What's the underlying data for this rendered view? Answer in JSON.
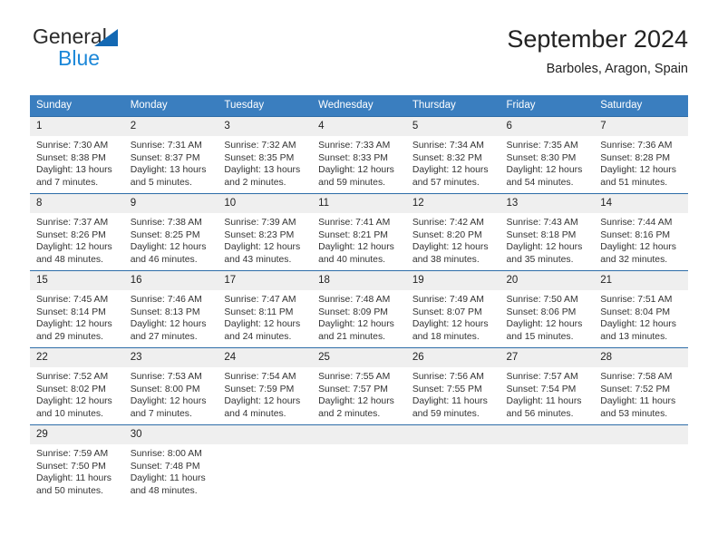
{
  "brand": {
    "name_part1": "General",
    "name_part2": "Blue",
    "triangle_color": "#1368b3",
    "blue_text_color": "#1b87d8"
  },
  "header": {
    "title": "September 2024",
    "subtitle": "Barboles, Aragon, Spain"
  },
  "theme": {
    "header_row_bg": "#3a7ebf",
    "row_divider": "#2e6da8",
    "daynum_bg": "#efefef"
  },
  "weekday_headers": [
    "Sunday",
    "Monday",
    "Tuesday",
    "Wednesday",
    "Thursday",
    "Friday",
    "Saturday"
  ],
  "weeks": [
    [
      {
        "day": "1",
        "sunrise": "Sunrise: 7:30 AM",
        "sunset": "Sunset: 8:38 PM",
        "daylight1": "Daylight: 13 hours",
        "daylight2": "and 7 minutes."
      },
      {
        "day": "2",
        "sunrise": "Sunrise: 7:31 AM",
        "sunset": "Sunset: 8:37 PM",
        "daylight1": "Daylight: 13 hours",
        "daylight2": "and 5 minutes."
      },
      {
        "day": "3",
        "sunrise": "Sunrise: 7:32 AM",
        "sunset": "Sunset: 8:35 PM",
        "daylight1": "Daylight: 13 hours",
        "daylight2": "and 2 minutes."
      },
      {
        "day": "4",
        "sunrise": "Sunrise: 7:33 AM",
        "sunset": "Sunset: 8:33 PM",
        "daylight1": "Daylight: 12 hours",
        "daylight2": "and 59 minutes."
      },
      {
        "day": "5",
        "sunrise": "Sunrise: 7:34 AM",
        "sunset": "Sunset: 8:32 PM",
        "daylight1": "Daylight: 12 hours",
        "daylight2": "and 57 minutes."
      },
      {
        "day": "6",
        "sunrise": "Sunrise: 7:35 AM",
        "sunset": "Sunset: 8:30 PM",
        "daylight1": "Daylight: 12 hours",
        "daylight2": "and 54 minutes."
      },
      {
        "day": "7",
        "sunrise": "Sunrise: 7:36 AM",
        "sunset": "Sunset: 8:28 PM",
        "daylight1": "Daylight: 12 hours",
        "daylight2": "and 51 minutes."
      }
    ],
    [
      {
        "day": "8",
        "sunrise": "Sunrise: 7:37 AM",
        "sunset": "Sunset: 8:26 PM",
        "daylight1": "Daylight: 12 hours",
        "daylight2": "and 48 minutes."
      },
      {
        "day": "9",
        "sunrise": "Sunrise: 7:38 AM",
        "sunset": "Sunset: 8:25 PM",
        "daylight1": "Daylight: 12 hours",
        "daylight2": "and 46 minutes."
      },
      {
        "day": "10",
        "sunrise": "Sunrise: 7:39 AM",
        "sunset": "Sunset: 8:23 PM",
        "daylight1": "Daylight: 12 hours",
        "daylight2": "and 43 minutes."
      },
      {
        "day": "11",
        "sunrise": "Sunrise: 7:41 AM",
        "sunset": "Sunset: 8:21 PM",
        "daylight1": "Daylight: 12 hours",
        "daylight2": "and 40 minutes."
      },
      {
        "day": "12",
        "sunrise": "Sunrise: 7:42 AM",
        "sunset": "Sunset: 8:20 PM",
        "daylight1": "Daylight: 12 hours",
        "daylight2": "and 38 minutes."
      },
      {
        "day": "13",
        "sunrise": "Sunrise: 7:43 AM",
        "sunset": "Sunset: 8:18 PM",
        "daylight1": "Daylight: 12 hours",
        "daylight2": "and 35 minutes."
      },
      {
        "day": "14",
        "sunrise": "Sunrise: 7:44 AM",
        "sunset": "Sunset: 8:16 PM",
        "daylight1": "Daylight: 12 hours",
        "daylight2": "and 32 minutes."
      }
    ],
    [
      {
        "day": "15",
        "sunrise": "Sunrise: 7:45 AM",
        "sunset": "Sunset: 8:14 PM",
        "daylight1": "Daylight: 12 hours",
        "daylight2": "and 29 minutes."
      },
      {
        "day": "16",
        "sunrise": "Sunrise: 7:46 AM",
        "sunset": "Sunset: 8:13 PM",
        "daylight1": "Daylight: 12 hours",
        "daylight2": "and 27 minutes."
      },
      {
        "day": "17",
        "sunrise": "Sunrise: 7:47 AM",
        "sunset": "Sunset: 8:11 PM",
        "daylight1": "Daylight: 12 hours",
        "daylight2": "and 24 minutes."
      },
      {
        "day": "18",
        "sunrise": "Sunrise: 7:48 AM",
        "sunset": "Sunset: 8:09 PM",
        "daylight1": "Daylight: 12 hours",
        "daylight2": "and 21 minutes."
      },
      {
        "day": "19",
        "sunrise": "Sunrise: 7:49 AM",
        "sunset": "Sunset: 8:07 PM",
        "daylight1": "Daylight: 12 hours",
        "daylight2": "and 18 minutes."
      },
      {
        "day": "20",
        "sunrise": "Sunrise: 7:50 AM",
        "sunset": "Sunset: 8:06 PM",
        "daylight1": "Daylight: 12 hours",
        "daylight2": "and 15 minutes."
      },
      {
        "day": "21",
        "sunrise": "Sunrise: 7:51 AM",
        "sunset": "Sunset: 8:04 PM",
        "daylight1": "Daylight: 12 hours",
        "daylight2": "and 13 minutes."
      }
    ],
    [
      {
        "day": "22",
        "sunrise": "Sunrise: 7:52 AM",
        "sunset": "Sunset: 8:02 PM",
        "daylight1": "Daylight: 12 hours",
        "daylight2": "and 10 minutes."
      },
      {
        "day": "23",
        "sunrise": "Sunrise: 7:53 AM",
        "sunset": "Sunset: 8:00 PM",
        "daylight1": "Daylight: 12 hours",
        "daylight2": "and 7 minutes."
      },
      {
        "day": "24",
        "sunrise": "Sunrise: 7:54 AM",
        "sunset": "Sunset: 7:59 PM",
        "daylight1": "Daylight: 12 hours",
        "daylight2": "and 4 minutes."
      },
      {
        "day": "25",
        "sunrise": "Sunrise: 7:55 AM",
        "sunset": "Sunset: 7:57 PM",
        "daylight1": "Daylight: 12 hours",
        "daylight2": "and 2 minutes."
      },
      {
        "day": "26",
        "sunrise": "Sunrise: 7:56 AM",
        "sunset": "Sunset: 7:55 PM",
        "daylight1": "Daylight: 11 hours",
        "daylight2": "and 59 minutes."
      },
      {
        "day": "27",
        "sunrise": "Sunrise: 7:57 AM",
        "sunset": "Sunset: 7:54 PM",
        "daylight1": "Daylight: 11 hours",
        "daylight2": "and 56 minutes."
      },
      {
        "day": "28",
        "sunrise": "Sunrise: 7:58 AM",
        "sunset": "Sunset: 7:52 PM",
        "daylight1": "Daylight: 11 hours",
        "daylight2": "and 53 minutes."
      }
    ],
    [
      {
        "day": "29",
        "sunrise": "Sunrise: 7:59 AM",
        "sunset": "Sunset: 7:50 PM",
        "daylight1": "Daylight: 11 hours",
        "daylight2": "and 50 minutes."
      },
      {
        "day": "30",
        "sunrise": "Sunrise: 8:00 AM",
        "sunset": "Sunset: 7:48 PM",
        "daylight1": "Daylight: 11 hours",
        "daylight2": "and 48 minutes."
      },
      {
        "day": "",
        "sunrise": "",
        "sunset": "",
        "daylight1": "",
        "daylight2": ""
      },
      {
        "day": "",
        "sunrise": "",
        "sunset": "",
        "daylight1": "",
        "daylight2": ""
      },
      {
        "day": "",
        "sunrise": "",
        "sunset": "",
        "daylight1": "",
        "daylight2": ""
      },
      {
        "day": "",
        "sunrise": "",
        "sunset": "",
        "daylight1": "",
        "daylight2": ""
      },
      {
        "day": "",
        "sunrise": "",
        "sunset": "",
        "daylight1": "",
        "daylight2": ""
      }
    ]
  ]
}
